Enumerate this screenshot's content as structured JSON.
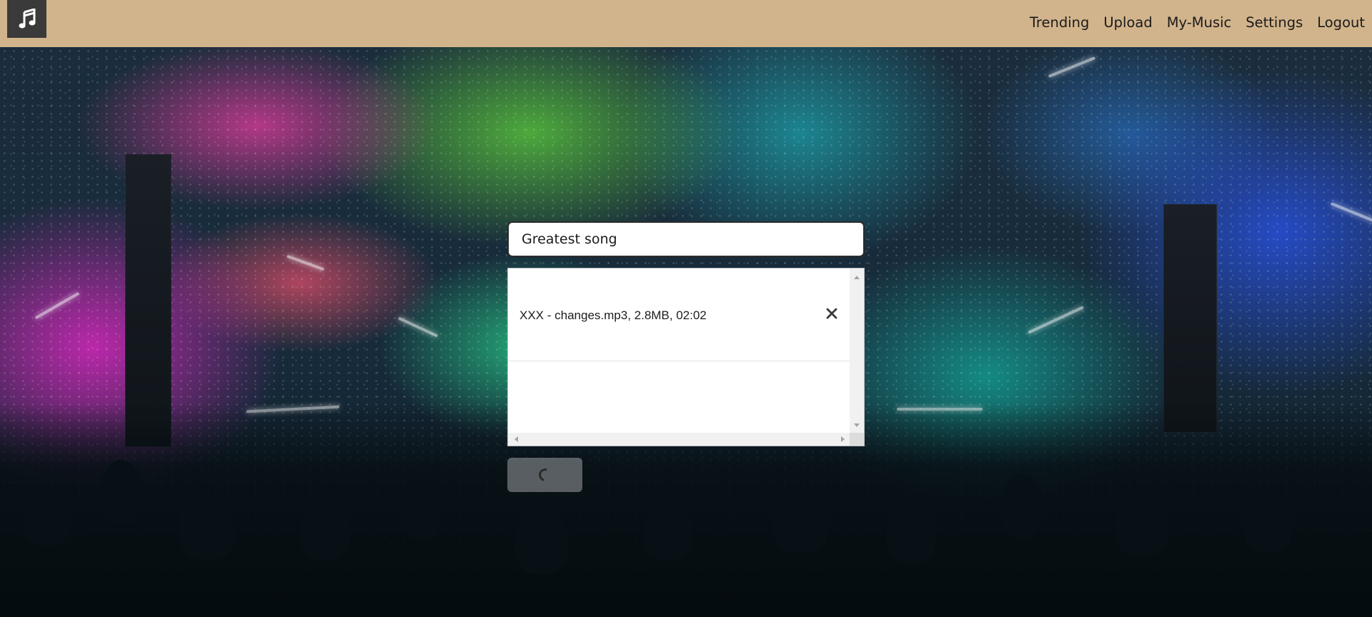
{
  "app": {
    "logo_icon": "music-note-icon"
  },
  "nav": {
    "items": [
      {
        "label": "Trending"
      },
      {
        "label": "Upload"
      },
      {
        "label": "My-Music"
      },
      {
        "label": "Settings"
      },
      {
        "label": "Logout"
      }
    ]
  },
  "form": {
    "title_value": "Greatest song",
    "files": [
      {
        "text": "XXX - changes.mp3, 2.8MB, 02:02",
        "remove_icon": "close-icon"
      }
    ],
    "upload_button": {
      "state": "loading",
      "icon": "spinner-icon"
    }
  },
  "colors": {
    "topbar": "#d2b48c",
    "logo_bg": "#3a3a3a"
  }
}
